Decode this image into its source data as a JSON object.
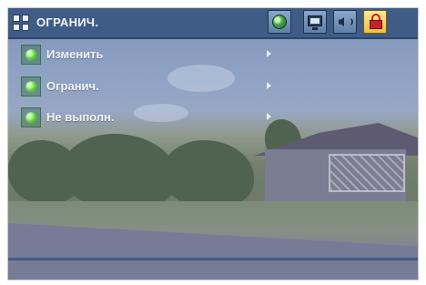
{
  "header": {
    "title": "ОГРАНИЧ.",
    "icons": [
      "settings-grid-icon",
      "globe-icon",
      "monitor-icon",
      "speaker-icon",
      "lock-icon"
    ],
    "active_icon": "lock-icon"
  },
  "menu": {
    "items": [
      {
        "label": "Изменить"
      },
      {
        "label": "Огранич."
      },
      {
        "label": "Не выполн."
      }
    ]
  },
  "colors": {
    "header": "#3f5c87",
    "active_tab": "#f0c038",
    "bullet": "#66d246"
  }
}
